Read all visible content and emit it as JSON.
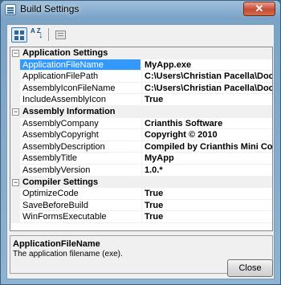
{
  "window": {
    "title": "Build Settings",
    "close_glyph": "✕"
  },
  "toolbar": {
    "buttons": [
      {
        "name": "categorized-icon",
        "active": true
      },
      {
        "name": "alphabetical-icon",
        "active": false,
        "glyph_top": "A Z",
        "glyph_arrow": "↓"
      },
      {
        "name": "property-pages-icon",
        "active": false
      }
    ]
  },
  "grid": {
    "categories": [
      {
        "label": "Application Settings",
        "toggle": "−",
        "properties": [
          {
            "name": "ApplicationFileName",
            "value": "MyApp.exe",
            "selected": true
          },
          {
            "name": "ApplicationFilePath",
            "value": "C:\\Users\\Christian Pacella\\Docum"
          },
          {
            "name": "AssemblyIconFileName",
            "value": "C:\\Users\\Christian Pacella\\Docum"
          },
          {
            "name": "IncludeAssemblyIcon",
            "value": "True"
          }
        ]
      },
      {
        "label": "Assembly Information",
        "toggle": "−",
        "properties": [
          {
            "name": "AssemblyCompany",
            "value": "Crianthis Software"
          },
          {
            "name": "AssemblyCopyright",
            "value": "Copyright © 2010"
          },
          {
            "name": "AssemblyDescription",
            "value": "Compiled by Crianthis Mini Compile"
          },
          {
            "name": "AssemblyTitle",
            "value": "MyApp"
          },
          {
            "name": "AssemblyVersion",
            "value": "1.0.*"
          }
        ]
      },
      {
        "label": "Compiler Settings",
        "toggle": "−",
        "properties": [
          {
            "name": "OptimizeCode",
            "value": "True"
          },
          {
            "name": "SaveBeforeBuild",
            "value": "True"
          },
          {
            "name": "WinFormsExecutable",
            "value": "True"
          }
        ]
      }
    ]
  },
  "help": {
    "title": "ApplicationFileName",
    "description": "The application filename (exe)."
  },
  "footer": {
    "close_label": "Close"
  },
  "colors": {
    "selection": "#3399ff",
    "title_bar": "#9fc0dc",
    "close_button": "#c74a31"
  }
}
